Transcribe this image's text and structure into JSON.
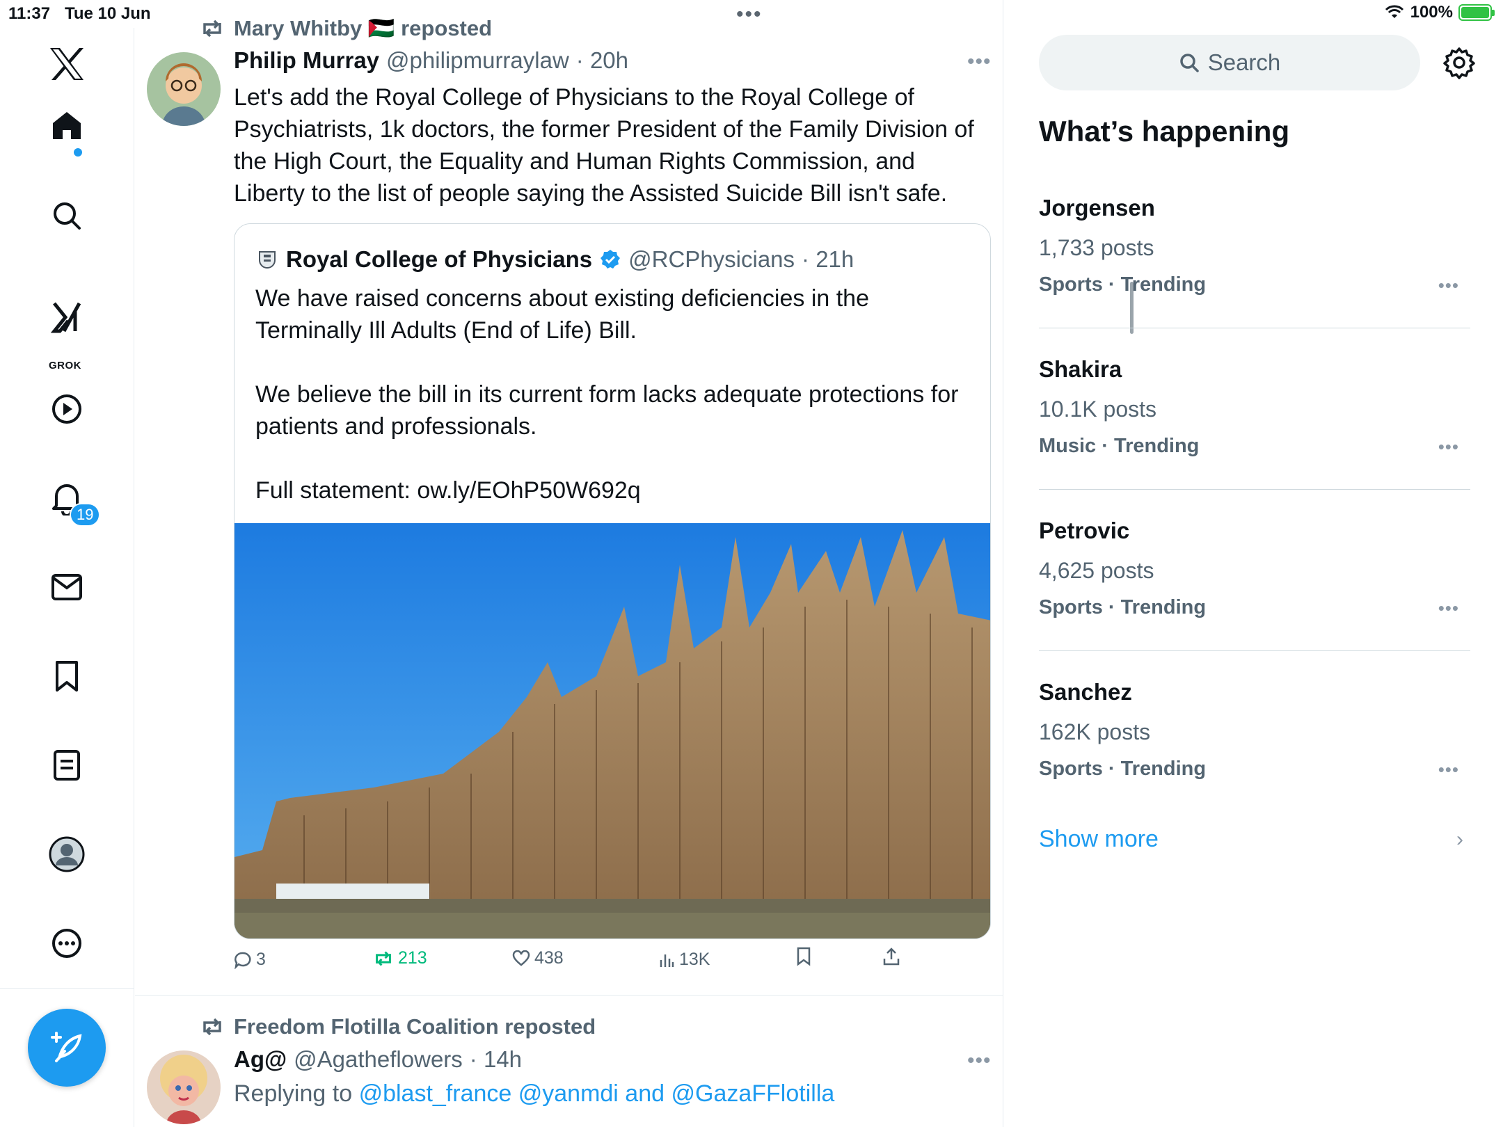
{
  "status_bar": {
    "time": "11:37",
    "date": "Tue 10 Jun",
    "battery": "100%"
  },
  "nav": {
    "notifications_badge": "19",
    "grok_label": "GROK"
  },
  "tweet1": {
    "repost_by": "Mary Whitby 🇵🇸 reposted",
    "name": "Philip Murray",
    "handle": "@philipmurraylaw",
    "time": "· 20h",
    "text": "Let's add the Royal College of Physicians to the Royal College of Psychiatrists, 1k doctors, the former President of the Family Division of the High Court, the Equality and Human Rights Commission, and Liberty to the list of people saying the Assisted Suicide Bill isn't safe.",
    "quote": {
      "name": "Royal College of Physicians",
      "handle": "@RCPhysicians",
      "time": "· 21h",
      "p1": "We have raised concerns about existing deficiencies in the Terminally Ill Adults (End of Life) Bill.",
      "p2": "We believe the bill in its current form lacks adequate protections for patients and professionals.",
      "p3": "Full statement: ow.ly/EOhP50W692q"
    },
    "actions": {
      "replies": "3",
      "reposts": "213",
      "likes": "438",
      "views": "13K"
    }
  },
  "tweet2": {
    "repost_by": "Freedom Flotilla Coalition reposted",
    "name": "Ag@",
    "handle": "@Agatheflowers",
    "time": "· 14h",
    "reply_prefix": "Replying to",
    "mentions": "@blast_france @yanmdi and @GazaFFlotilla"
  },
  "sidebar_right": {
    "search_placeholder": "Search",
    "section_title": "What’s happening",
    "trends": [
      {
        "name": "Jorgensen",
        "posts": "1,733 posts",
        "category": "Sports · Trending"
      },
      {
        "name": "Shakira",
        "posts": "10.1K posts",
        "category": "Music · Trending"
      },
      {
        "name": "Petrovic",
        "posts": "4,625 posts",
        "category": "Sports · Trending"
      },
      {
        "name": "Sanchez",
        "posts": "162K posts",
        "category": "Sports · Trending"
      }
    ],
    "show_more": "Show more"
  },
  "colors": {
    "accent": "#1d9bf0",
    "repost_green": "#00ba7c",
    "secondary_text": "#536471"
  }
}
